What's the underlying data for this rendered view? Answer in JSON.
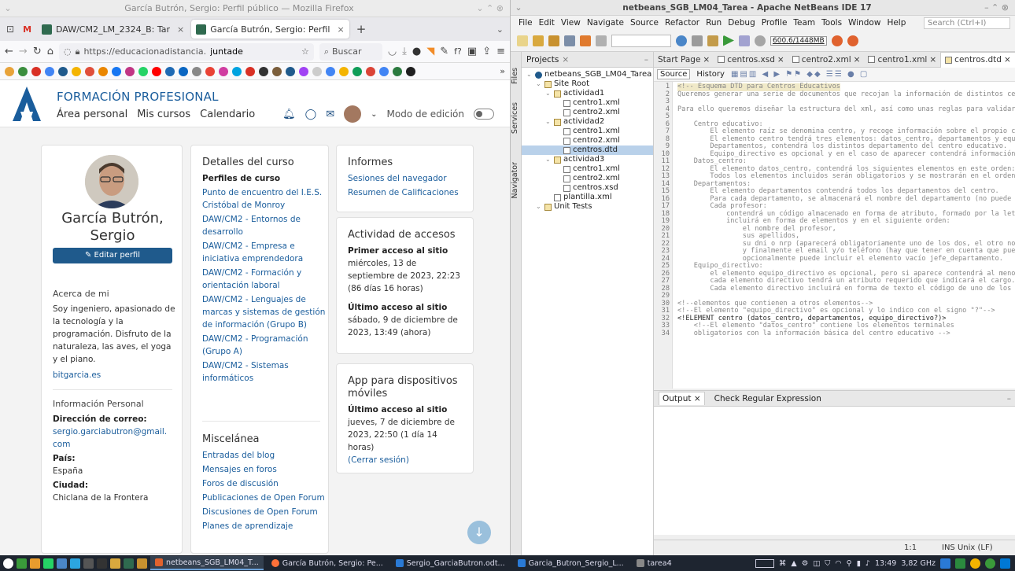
{
  "firefox": {
    "window_title": "García Butrón, Sergio: Perfil público — Mozilla Firefox",
    "tabs": [
      {
        "label": "DAW/CM2_LM_2324_B: Tar",
        "close": "×"
      },
      {
        "label": "García Butrón, Sergio: Perfil",
        "close": "×"
      }
    ],
    "new_tab": "+",
    "url_prefix": "https://educacionadistancia.",
    "url_domain": "juntade",
    "search_placeholder": "Buscar"
  },
  "site": {
    "brand": "FORMACIÓN PROFESIONAL",
    "nav": [
      "Área personal",
      "Mis cursos",
      "Calendario"
    ],
    "edit_mode_label": "Modo de edición"
  },
  "profile": {
    "name": "García Butrón, Sergio",
    "edit_button": "✎ Editar perfil",
    "about_heading": "Acerca de mi",
    "about_text": "Soy ingeniero, apasionado de la tecnología y la programación. Disfruto de la naturaleza, las aves, el yoga y el piano.",
    "website": "bitgarcia.es",
    "personal_heading": "Información Personal",
    "email_label": "Dirección de correo:",
    "email": "sergio.garciabutron@gmail.com",
    "country_label": "País:",
    "country": "España",
    "city_label": "Ciudad:",
    "city": "Chiclana de la Frontera"
  },
  "course_details": {
    "heading": "Detalles del curso",
    "profiles_label": "Perfiles de curso",
    "courses": [
      "Punto de encuentro del I.E.S. Cristóbal de Monroy",
      "DAW/CM2 - Entornos de desarrollo",
      "DAW/CM2 - Empresa e iniciativa emprendedora",
      "DAW/CM2 - Formación y orientación laboral",
      "DAW/CM2 - Lenguajes de marcas y sistemas de gestión de información (Grupo B)",
      "DAW/CM2 - Programación (Grupo A)",
      "DAW/CM2 - Sistemas informáticos"
    ]
  },
  "misc": {
    "heading": "Miscelánea",
    "links": [
      "Entradas del blog",
      "Mensajes en foros",
      "Foros de discusión",
      "Publicaciones de Open Forum",
      "Discusiones de Open Forum",
      "Planes de aprendizaje"
    ]
  },
  "reports": {
    "heading": "Informes",
    "links": [
      "Sesiones del navegador",
      "Resumen de Calificaciones"
    ]
  },
  "access": {
    "heading": "Actividad de accesos",
    "first_label": "Primer acceso al sitio",
    "first_value": "miércoles, 13 de septiembre de 2023, 22:23  (86 días 16 horas)",
    "last_label": "Último acceso al sitio",
    "last_value": "sábado, 9 de diciembre de 2023, 13:49  (ahora)"
  },
  "mobile": {
    "heading": "App para dispositivos móviles",
    "last_label": "Último acceso al sitio",
    "last_value": "jueves, 7 de diciembre de 2023, 22:50  (1 día 14 horas)",
    "logout": "(Cerrar sesión)"
  },
  "netbeans": {
    "title": "netbeans_SGB_LM04_Tarea - Apache NetBeans IDE 17",
    "menu": [
      "File",
      "Edit",
      "View",
      "Navigate",
      "Source",
      "Refactor",
      "Run",
      "Debug",
      "Profile",
      "Team",
      "Tools",
      "Window",
      "Help"
    ],
    "search_placeholder": "Search (Ctrl+I)",
    "memory": "600.6/1448MB",
    "side_tabs": [
      "Files",
      "Services",
      "Navigator"
    ],
    "projects_tab": "Projects",
    "tree": [
      {
        "label": "netbeans_SGB_LM04_Tarea",
        "depth": 0,
        "kind": "project"
      },
      {
        "label": "Site Root",
        "depth": 1,
        "kind": "folder"
      },
      {
        "label": "actividad1",
        "depth": 2,
        "kind": "folder"
      },
      {
        "label": "centro1.xml",
        "depth": 3,
        "kind": "file"
      },
      {
        "label": "centro2.xml",
        "depth": 3,
        "kind": "file"
      },
      {
        "label": "actividad2",
        "depth": 2,
        "kind": "folder"
      },
      {
        "label": "centro1.xml",
        "depth": 3,
        "kind": "file"
      },
      {
        "label": "centro2.xml",
        "depth": 3,
        "kind": "file"
      },
      {
        "label": "centros.dtd",
        "depth": 3,
        "kind": "file",
        "selected": true
      },
      {
        "label": "actividad3",
        "depth": 2,
        "kind": "folder"
      },
      {
        "label": "centro1.xml",
        "depth": 3,
        "kind": "file"
      },
      {
        "label": "centro2.xml",
        "depth": 3,
        "kind": "file"
      },
      {
        "label": "centros.xsd",
        "depth": 3,
        "kind": "file"
      },
      {
        "label": "plantilla.xml",
        "depth": 2,
        "kind": "file"
      },
      {
        "label": "Unit Tests",
        "depth": 1,
        "kind": "folder"
      }
    ],
    "editor_tabs": [
      "Start Page",
      "centros.xsd",
      "centro2.xml",
      "centro1.xml",
      "centros.dtd"
    ],
    "source_tab": "Source",
    "history_tab": "History",
    "code_lines": [
      "<!-- Esquema DTD para Centros Educativos",
      "Queremos generar una serie de documentos que recojan la información de distintos centros educativos.",
      "",
      "Para ello queremos diseñar la estructura del xml, así como unas reglas para validarlo.",
      "",
      "    Centro educativo:",
      "        El elemento raíz se denomina centro, y recoge información sobre el propio centro.",
      "        El elemento centro tendrá tres elementos: datos_centro, departamentos y equipo_directivo",
      "        Departamentos, contendrá los distintos departamento del centro educativo.",
      "        Equipo_directivo es opcional y en el caso de aparecer contendrá información del equipo.",
      "    Datos_centro:",
      "        El elemento datos_centro, contendrá los siguientes elementos en este orden:",
      "        Todos los elementos incluidos serán obligatorios y se mostrarán en el orden indicado.",
      "    Departamentos:",
      "        El elemento departamentos contendrá todos los departamentos del centro.",
      "        Para cada departamento, se almacenará el nombre del departamento (no puede repetirse).",
      "        Cada profesor:",
      "            contendrá un código almacenado en forma de atributo, formado por la letra P.",
      "            incluirá en forma de elementos y en el siguiente orden:",
      "                el nombre del profesor,",
      "                sus apellidos,",
      "                su dni o nrp (aparecerá obligatoriamente uno de los dos, el otro no)",
      "                y finalmente el email y/o teléfono (hay que tener en cuenta que puede haber varios)",
      "                opcionalmente puede incluir el elemento vacío jefe_departamento.",
      "    Equipo_directivo:",
      "        el elemento equipo_directivo es opcional, pero si aparece contendrá al menos un directivo.",
      "        cada elemento directivo tendrá un atributo requerido que indicará el cargo.",
      "        Cada elemento directivo incluirá en forma de texto el código de uno de los profesores.",
      "",
      "<!--elementos que contienen a otros elementos-->",
      "<!--El elemento \"equipo_directivo\" es opcional y lo indico con el signo \"?\"-->",
      "<!ELEMENT centro (datos_centro, departamentos, equipo_directivo?)>",
      "    <!--El elemento \"datos_centro\" contiene los elementos terminales",
      "    obligatorios con la información básica del centro educativo -->"
    ],
    "output_tabs": [
      "Output",
      "Check Regular Expression"
    ],
    "status_pos": "1:1",
    "status_mode": "INS Unix (LF)"
  },
  "taskbar": {
    "tasks": [
      "netbeans_SGB_LM04_T...",
      "García Butrón, Sergio: Pe...",
      "Sergio_GarciaButron.odt...",
      "Garcia_Butron_Sergio_L...",
      "tarea4"
    ],
    "clock": "13:49",
    "cpu": "3,82 GHz"
  },
  "colors": {
    "brand_blue": "#1a5d9c",
    "button_blue": "#1f5a8c",
    "netbeans_selection": "#b9d1ea",
    "taskbar_bg": "#1e2530"
  }
}
